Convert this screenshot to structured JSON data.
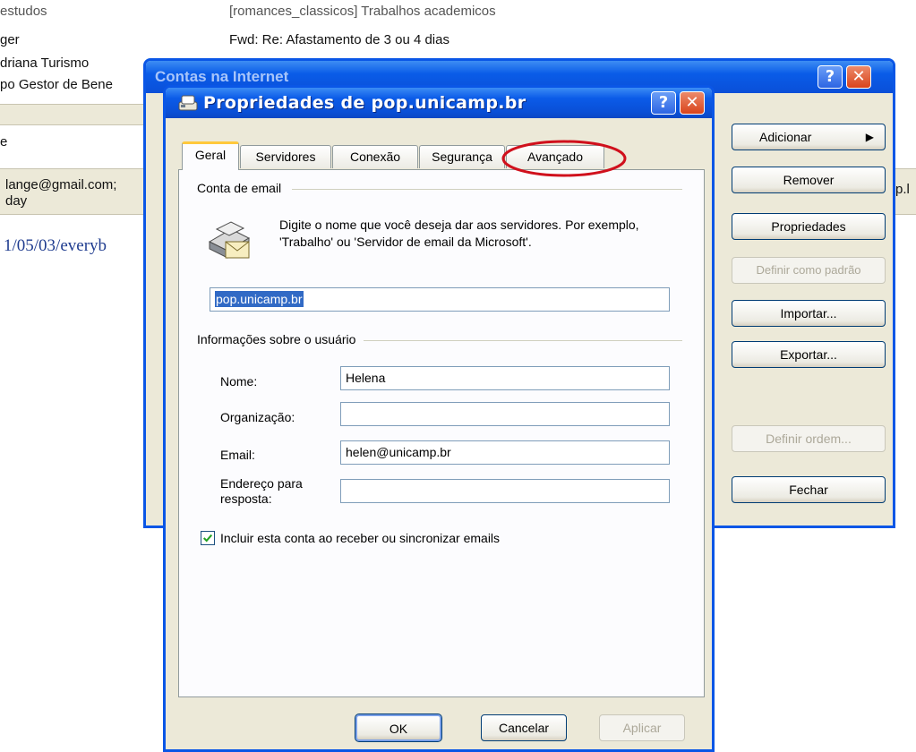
{
  "background": {
    "rows_left": [
      "estudos",
      "ger",
      "driana Turismo",
      "po Gestor de Bene"
    ],
    "subject_top": "[romances_classicos] Trabalhos academicos",
    "subject_fwd": "Fwd: Re: Afastamento de 3 ou 4 dias",
    "band_text": "e",
    "email_from": "lange@gmail.com;",
    "email_day": "day",
    "link_text": "1/05/03/everyb",
    "right_peek": "p.l"
  },
  "outer_dialog": {
    "title": "Contas na Internet",
    "help_label": "?",
    "close_label": "✕",
    "buttons": {
      "add": "Adicionar",
      "remove": "Remover",
      "properties": "Propriedades",
      "set_default": "Definir como padrão",
      "import": "Importar...",
      "export": "Exportar...",
      "set_order": "Definir ordem...",
      "close": "Fechar"
    }
  },
  "dialog": {
    "title": "Propriedades de pop.unicamp.br",
    "help_label": "?",
    "close_label": "✕",
    "tabs": [
      "Geral",
      "Servidores",
      "Conexão",
      "Segurança",
      "Avançado"
    ],
    "active_tab": "Geral",
    "highlighted_tab": "Avançado",
    "annotation_color": "#d0101c",
    "account_group": "Conta de email",
    "account_description": "Digite o nome que você deseja dar aos servidores. Por exemplo, 'Trabalho' ou 'Servidor de email da Microsoft'.",
    "account_name": "pop.unicamp.br",
    "user_group": "Informações sobre o usuário",
    "fields": {
      "name_label": "Nome:",
      "name_value": "Helena",
      "org_label": "Organização:",
      "org_value": "",
      "email_label": "Email:",
      "email_value": "helen@unicamp.br",
      "reply_label": "Endereço para resposta:",
      "reply_value": ""
    },
    "include_checkbox": {
      "label": "Incluir esta conta ao receber ou sincronizar emails",
      "checked": true
    },
    "buttons": {
      "ok": "OK",
      "cancel": "Cancelar",
      "apply": "Aplicar"
    }
  }
}
